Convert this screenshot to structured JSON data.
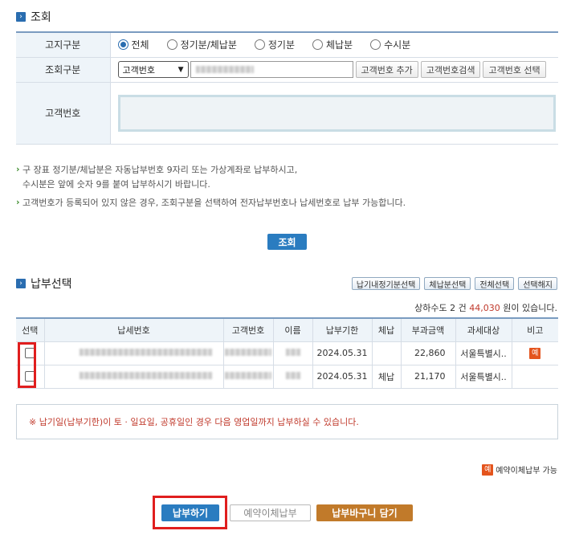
{
  "section_inquiry": {
    "title": "조회",
    "icon": "section-arrow-icon"
  },
  "form": {
    "notice_type_label": "고지구분",
    "notice_types": [
      "전체",
      "정기분/체납분",
      "정기분",
      "체납분",
      "수시분"
    ],
    "notice_type_selected": "전체",
    "search_type_label": "조회구분",
    "search_type_value": "고객번호",
    "add_button": "고객번호 추가",
    "search_button": "고객번호검색",
    "select_button": "고객번호 선택",
    "customer_no_label": "고객번호"
  },
  "notes": [
    "구 장표 정기분/체납분은 자동납부번호 9자리 또는 가상계좌로 납부하시고,",
    "수시분은 앞에 숫자 9를 붙여 납부하시기 바랍니다.",
    "고객번호가 등록되어 있지 않은 경우, 조회구분을 선택하여 전자납부번호나 납세번호로 납부 가능합니다."
  ],
  "inquiry_button": "조회",
  "section_payment": {
    "title": "납부선택",
    "icon": "section-arrow-icon"
  },
  "tools": [
    "납기내정기분선택",
    "체납분선택",
    "전체선택",
    "선택해지"
  ],
  "summary": {
    "prefix": "상하수도",
    "count": "2",
    "mid": "건",
    "amount": "44,030",
    "suffix": "원이 있습니다."
  },
  "table": {
    "headers": [
      "선택",
      "납세번호",
      "고객번호",
      "이름",
      "납부기한",
      "체납",
      "부과금액",
      "과세대상",
      "비고"
    ],
    "rows": [
      {
        "due": "2024.05.31",
        "overdue": "",
        "amount": "22,860",
        "target": "서울특별시..",
        "note_badge": "예"
      },
      {
        "due": "2024.05.31",
        "overdue": "체납",
        "amount": "21,170",
        "target": "서울특별시..",
        "note_badge": ""
      }
    ]
  },
  "notice_text": "※ 납기일(납부기한)이 토 · 일요일, 공휴일인 경우 다음 영업일까지 납부하실 수 있습니다.",
  "legend": {
    "badge": "예",
    "label": "예약이체납부 가능"
  },
  "bottom": {
    "pay": "납부하기",
    "reserve": "예약이체납부",
    "cart": "납부바구니 담기"
  },
  "colors": {
    "accent": "#2a7cc0",
    "highlight": "#e01e1e",
    "cart": "#c17a2a"
  }
}
